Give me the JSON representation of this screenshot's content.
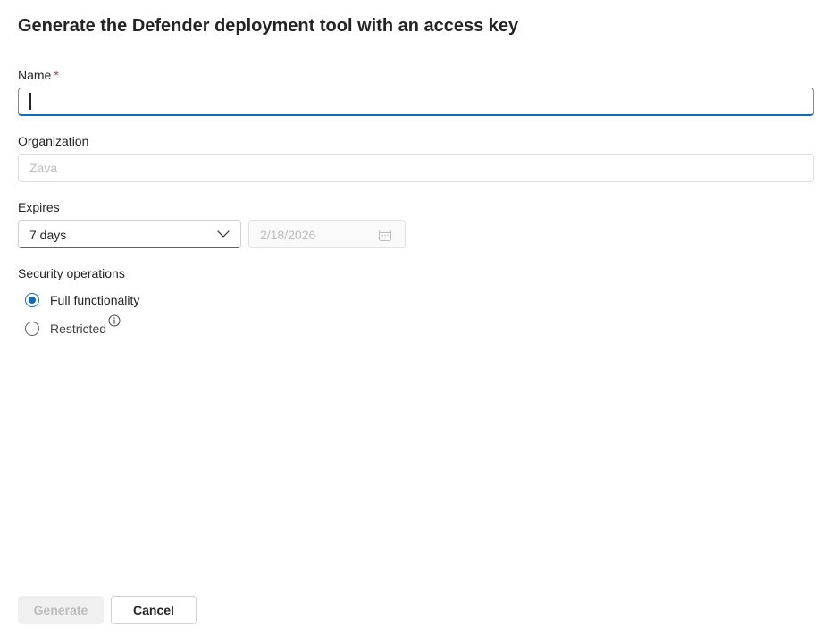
{
  "dialog": {
    "title": "Generate the Defender deployment tool with an access key"
  },
  "form": {
    "name": {
      "label": "Name",
      "required_mark": "*",
      "value": ""
    },
    "organization": {
      "label": "Organization",
      "placeholder": "Zava"
    },
    "expires": {
      "label": "Expires",
      "selected": "7 days",
      "date_value": "2/18/2026"
    },
    "security_operations": {
      "label": "Security operations",
      "options": [
        {
          "label": "Full functionality",
          "checked": true
        },
        {
          "label": "Restricted",
          "checked": false
        }
      ]
    }
  },
  "footer": {
    "generate_label": "Generate",
    "cancel_label": "Cancel"
  },
  "colors": {
    "accent": "#0f6cbd",
    "required": "#c4314b",
    "disabled_text": "#bdbdbd"
  }
}
